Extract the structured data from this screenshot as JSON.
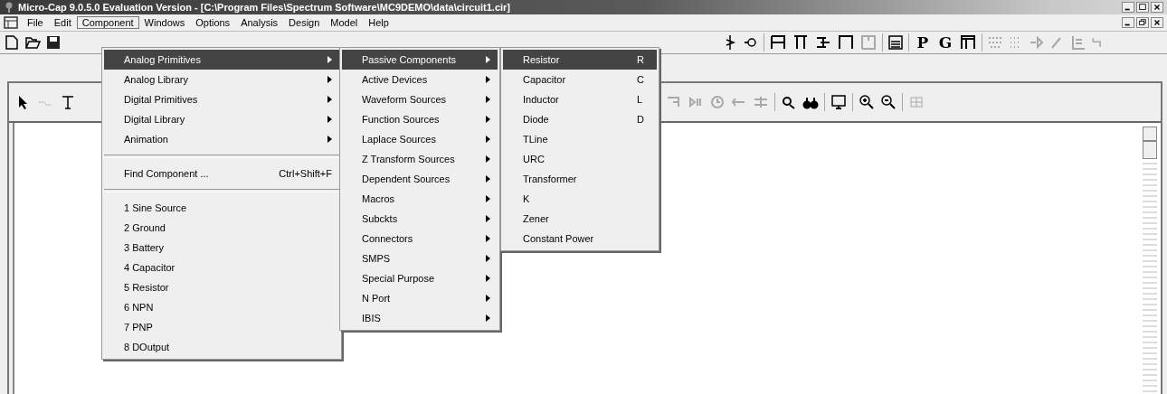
{
  "window": {
    "title": "Micro-Cap 9.0.5.0 Evaluation Version - [C:\\Program Files\\Spectrum Software\\MC9DEMO\\data\\circuit1.cir]"
  },
  "menubar": [
    {
      "label": "File",
      "selected": false
    },
    {
      "label": "Edit",
      "selected": false
    },
    {
      "label": "Component",
      "selected": true
    },
    {
      "label": "Windows",
      "selected": false
    },
    {
      "label": "Options",
      "selected": false
    },
    {
      "label": "Analysis",
      "selected": false
    },
    {
      "label": "Design",
      "selected": false
    },
    {
      "label": "Model",
      "selected": false
    },
    {
      "label": "Help",
      "selected": false
    }
  ],
  "toolbar": {
    "letter_buttons": [
      "P",
      "G"
    ]
  },
  "component_menu": [
    {
      "kind": "submenu",
      "label": "Analog Primitives",
      "selected": true
    },
    {
      "kind": "submenu",
      "label": "Analog Library",
      "selected": false
    },
    {
      "kind": "submenu",
      "label": "Digital Primitives",
      "selected": false
    },
    {
      "kind": "submenu",
      "label": "Digital Library",
      "selected": false
    },
    {
      "kind": "submenu",
      "label": "Animation",
      "selected": false
    },
    {
      "kind": "separator"
    },
    {
      "kind": "command",
      "label": "Find Component ...",
      "shortcut": "Ctrl+Shift+F",
      "selected": false
    },
    {
      "kind": "separator"
    },
    {
      "kind": "command",
      "label": "1 Sine Source",
      "selected": false
    },
    {
      "kind": "command",
      "label": "2 Ground",
      "selected": false
    },
    {
      "kind": "command",
      "label": "3 Battery",
      "selected": false
    },
    {
      "kind": "command",
      "label": "4 Capacitor",
      "selected": false
    },
    {
      "kind": "command",
      "label": "5 Resistor",
      "selected": false
    },
    {
      "kind": "command",
      "label": "6 NPN",
      "selected": false
    },
    {
      "kind": "command",
      "label": "7 PNP",
      "selected": false
    },
    {
      "kind": "command",
      "label": "8 DOutput",
      "selected": false
    }
  ],
  "analog_primitives_menu": [
    {
      "kind": "submenu",
      "label": "Passive Components",
      "selected": true
    },
    {
      "kind": "submenu",
      "label": "Active Devices",
      "selected": false
    },
    {
      "kind": "submenu",
      "label": "Waveform Sources",
      "selected": false
    },
    {
      "kind": "submenu",
      "label": "Function Sources",
      "selected": false
    },
    {
      "kind": "submenu",
      "label": "Laplace Sources",
      "selected": false
    },
    {
      "kind": "submenu",
      "label": "Z Transform Sources",
      "selected": false
    },
    {
      "kind": "submenu",
      "label": "Dependent Sources",
      "selected": false
    },
    {
      "kind": "submenu",
      "label": "Macros",
      "selected": false
    },
    {
      "kind": "submenu",
      "label": "Subckts",
      "selected": false
    },
    {
      "kind": "submenu",
      "label": "Connectors",
      "selected": false
    },
    {
      "kind": "submenu",
      "label": "SMPS",
      "selected": false
    },
    {
      "kind": "submenu",
      "label": "Special Purpose",
      "selected": false
    },
    {
      "kind": "submenu",
      "label": "N Port",
      "selected": false
    },
    {
      "kind": "submenu",
      "label": "IBIS",
      "selected": false
    }
  ],
  "passive_components_menu": [
    {
      "kind": "command",
      "label": "Resistor",
      "shortcut": "R",
      "selected": true
    },
    {
      "kind": "command",
      "label": "Capacitor",
      "shortcut": "C",
      "selected": false
    },
    {
      "kind": "command",
      "label": "Inductor",
      "shortcut": "L",
      "selected": false
    },
    {
      "kind": "command",
      "label": "Diode",
      "shortcut": "D",
      "selected": false
    },
    {
      "kind": "command",
      "label": "TLine",
      "selected": false
    },
    {
      "kind": "command",
      "label": "URC",
      "selected": false
    },
    {
      "kind": "command",
      "label": "Transformer",
      "selected": false
    },
    {
      "kind": "command",
      "label": "K",
      "selected": false
    },
    {
      "kind": "command",
      "label": "Zener",
      "selected": false
    },
    {
      "kind": "command",
      "label": "Constant Power",
      "selected": false
    }
  ]
}
